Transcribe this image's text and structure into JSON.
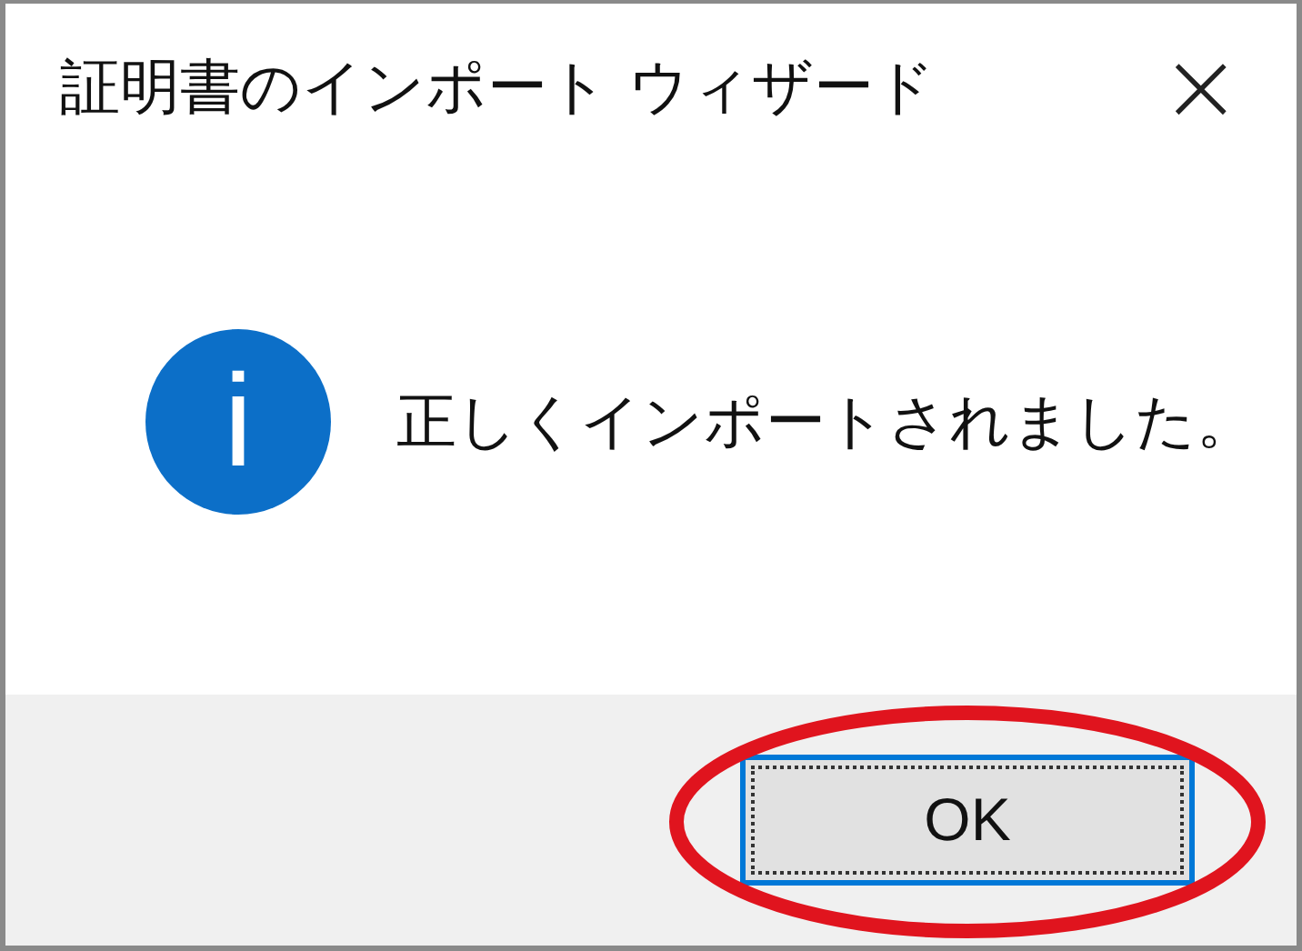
{
  "window": {
    "title": "証明書のインポート ウィザード",
    "close": "×"
  },
  "message": {
    "icon": "i",
    "text": "正しくインポートされました。"
  },
  "buttons": [
    {
      "label": "OK",
      "focused": true
    }
  ]
}
